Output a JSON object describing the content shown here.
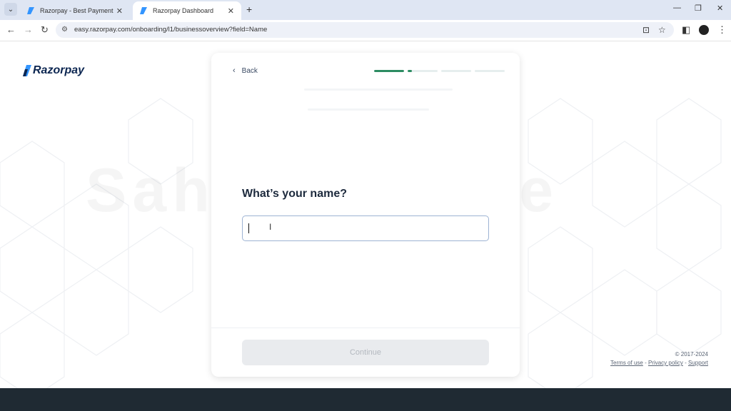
{
  "browser": {
    "tabs": [
      {
        "title": "Razorpay - Best Payment Soluti",
        "active": false
      },
      {
        "title": "Razorpay Dashboard",
        "active": true
      }
    ],
    "url": "easy.razorpay.com/onboarding/l1/businessoverview?field=Name",
    "icons": {
      "tab_menu": "⌄",
      "close": "✕",
      "new_tab": "+",
      "minimize": "—",
      "restore": "❐",
      "close_window": "✕",
      "back": "←",
      "forward": "→",
      "reload": "↻",
      "site_info": "⚙",
      "install": "⊡",
      "bookmark": "☆",
      "side_panel": "◧",
      "menu": "⋮"
    }
  },
  "logo": {
    "text": "Razorpay"
  },
  "watermark": "Sahil R Guide",
  "card": {
    "back_label": "Back",
    "back_icon": "‹",
    "progress_fills": [
      1.0,
      0.15,
      0,
      0
    ],
    "question": "What’s your name?",
    "name_value": "",
    "continue_label": "Continue",
    "cursor_glyph": "I"
  },
  "footer": {
    "copyright": "© 2017-2024",
    "terms": "Terms of use",
    "privacy": "Privacy policy",
    "support": "Support",
    "sep": " - "
  },
  "colors": {
    "brand": "#0c2651",
    "accent_green": "#2c8c62",
    "input_border": "#9db3d3",
    "bottom_bar": "#1f2a33"
  }
}
